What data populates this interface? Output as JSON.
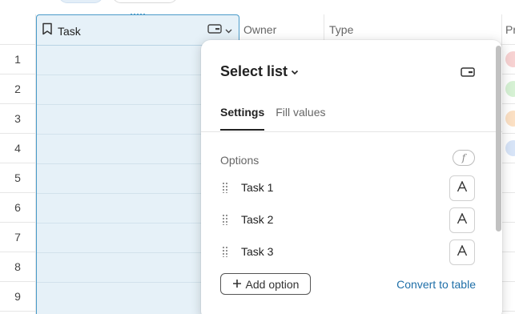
{
  "columns": {
    "task": "Task",
    "owner": "Owner",
    "type": "Type",
    "pr": "Pr"
  },
  "rows": [
    "1",
    "2",
    "3",
    "4",
    "5",
    "6",
    "7",
    "8",
    "9"
  ],
  "status_chips": [
    "#f7d2d2",
    "#d6f1d4",
    "#fbe0c4",
    "#d7e4f7"
  ],
  "panel": {
    "title": "Select list",
    "tabs": [
      {
        "label": "Settings",
        "active": true
      },
      {
        "label": "Fill values",
        "active": false
      }
    ],
    "options_label": "Options",
    "formula_icon": "f",
    "options": [
      {
        "label": "Task 1"
      },
      {
        "label": "Task 2"
      },
      {
        "label": "Task 3"
      }
    ],
    "add_option": "Add option",
    "convert": "Convert to table"
  },
  "colors": {
    "accent": "#4a9bc9",
    "selected_col": "#e6f1f8",
    "link": "#1f6fa8"
  }
}
